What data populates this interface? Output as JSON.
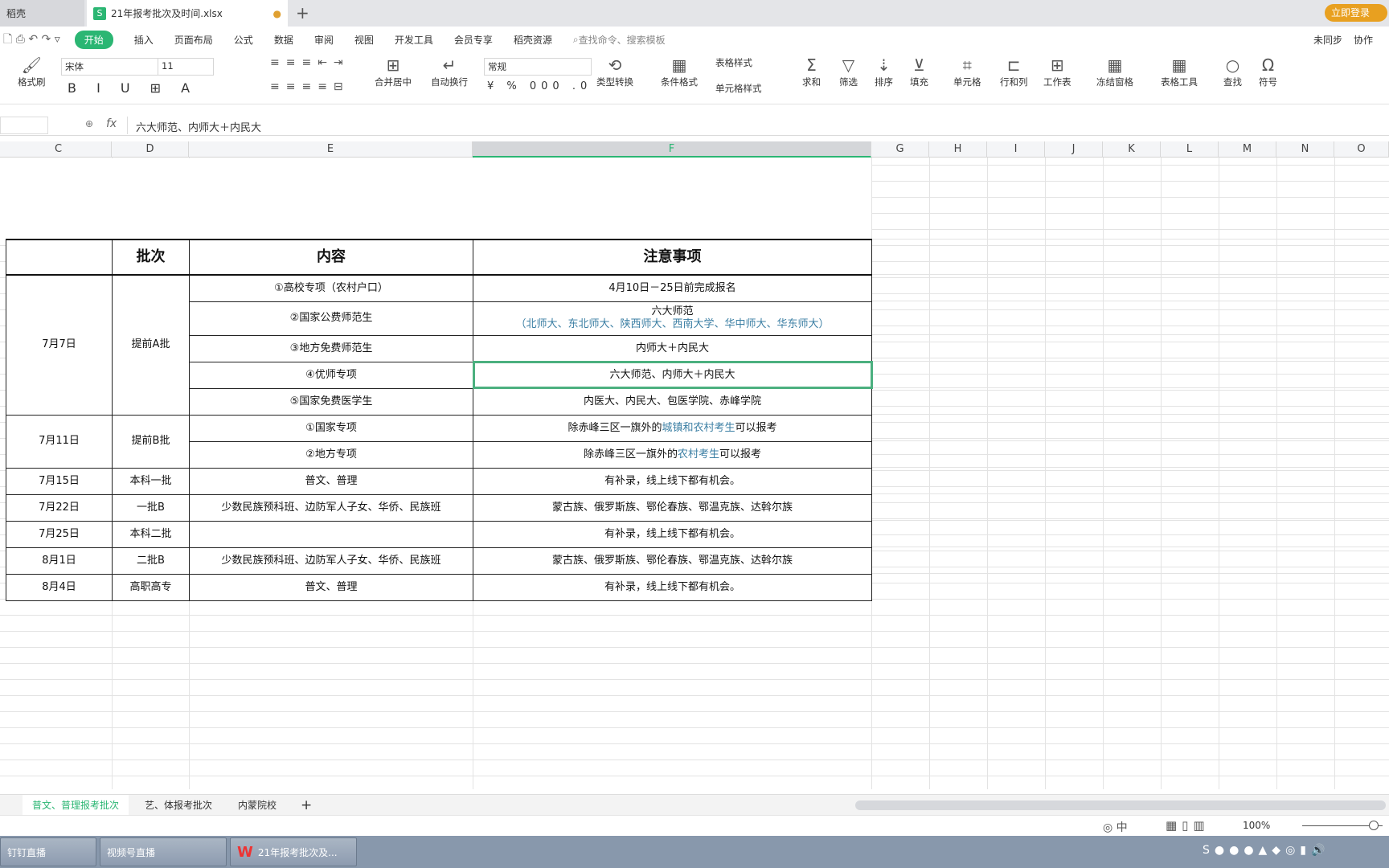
{
  "titlebar": {
    "tabs": [
      {
        "label": "稻壳"
      },
      {
        "label": "21年报考批次及时间.xlsx"
      }
    ],
    "new_tab": "+",
    "login": "立即登录"
  },
  "menu": {
    "items": [
      "开始",
      "插入",
      "页面布局",
      "公式",
      "数据",
      "审阅",
      "视图",
      "开发工具",
      "会员专享",
      "稻壳资源"
    ],
    "search": "查找命令、搜索模板",
    "sync": "未同步",
    "collab": "协作"
  },
  "toolbar": {
    "format_painter": "格式刷",
    "font": "宋体",
    "size": "11",
    "merge": "合并居中",
    "wrap": "自动换行",
    "number_format": "常规",
    "type_convert": "类型转换",
    "cond_format": "条件格式",
    "table_style": "表格样式",
    "cell_style": "单元格样式",
    "sum": "求和",
    "filter": "筛选",
    "sort": "排序",
    "fill": "填充",
    "cell": "单元格",
    "rowcol": "行和列",
    "sheet": "工作表",
    "freeze": "冻结窗格",
    "tools": "表格工具",
    "find": "查找",
    "symbol": "符号"
  },
  "formula_bar": {
    "fx": "fx",
    "value": "六大师范、内师大＋内民大"
  },
  "columns": [
    "C",
    "D",
    "E",
    "F",
    "G",
    "H",
    "I",
    "J",
    "K",
    "L",
    "M",
    "N",
    "O"
  ],
  "selected_column": "F",
  "table": {
    "headers": [
      "",
      "批次",
      "内容",
      "注意事项"
    ],
    "groupA": {
      "date": "7月7日",
      "batch": "提前A批",
      "rows": [
        {
          "content": "①高校专项（农村户口）",
          "note": "4月10日－25日前完成报名"
        },
        {
          "content": "②国家公费师范生",
          "note": "六大师范",
          "note2": "（北师大、东北师大、陕西师大、西南大学、华中师大、华东师大）"
        },
        {
          "content": "③地方免费师范生",
          "note": "内师大＋内民大"
        },
        {
          "content": "④优师专项",
          "note": "六大师范、内师大＋内民大"
        },
        {
          "content": "⑤国家免费医学生",
          "note": "内医大、内民大、包医学院、赤峰学院"
        }
      ]
    },
    "groupB": {
      "date": "7月11日",
      "batch": "提前B批",
      "rows": [
        {
          "content": "①国家专项",
          "note_a": "除赤峰三区一旗外的",
          "note_b": "城镇和农村考生",
          "note_c": "可以报考"
        },
        {
          "content": "②地方专项",
          "note_a": "除赤峰三区一旗外的",
          "note_b": "农村考生",
          "note_c": "可以报考"
        }
      ]
    },
    "rows": [
      {
        "date": "7月15日",
        "batch": "本科一批",
        "content": "普文、普理",
        "note": "有补录，线上线下都有机会。"
      },
      {
        "date": "7月22日",
        "batch": "一批B",
        "content": "少数民族预科班、边防军人子女、华侨、民族班",
        "note": "蒙古族、俄罗斯族、鄂伦春族、鄂温克族、达斡尔族"
      },
      {
        "date": "7月25日",
        "batch": "本科二批",
        "content": "",
        "note": "有补录，线上线下都有机会。"
      },
      {
        "date": "8月1日",
        "batch": "二批B",
        "content": "少数民族预科班、边防军人子女、华侨、民族班",
        "note": "蒙古族、俄罗斯族、鄂伦春族、鄂温克族、达斡尔族"
      },
      {
        "date": "8月4日",
        "batch": "高职高专",
        "content": "普文、普理",
        "note": "有补录，线上线下都有机会。"
      }
    ]
  },
  "sheets": [
    "普文、普理报考批次",
    "艺、体报考批次",
    "内蒙院校"
  ],
  "status": {
    "zoom": "100%",
    "zoom_fraction": 0.5
  },
  "taskbar": [
    "钉钉直播",
    "视频号直播",
    "21年报考批次及..."
  ],
  "colors": {
    "accent": "#2bb673",
    "link_blue": "#3a7ea3",
    "selection": "#4bb07f"
  }
}
